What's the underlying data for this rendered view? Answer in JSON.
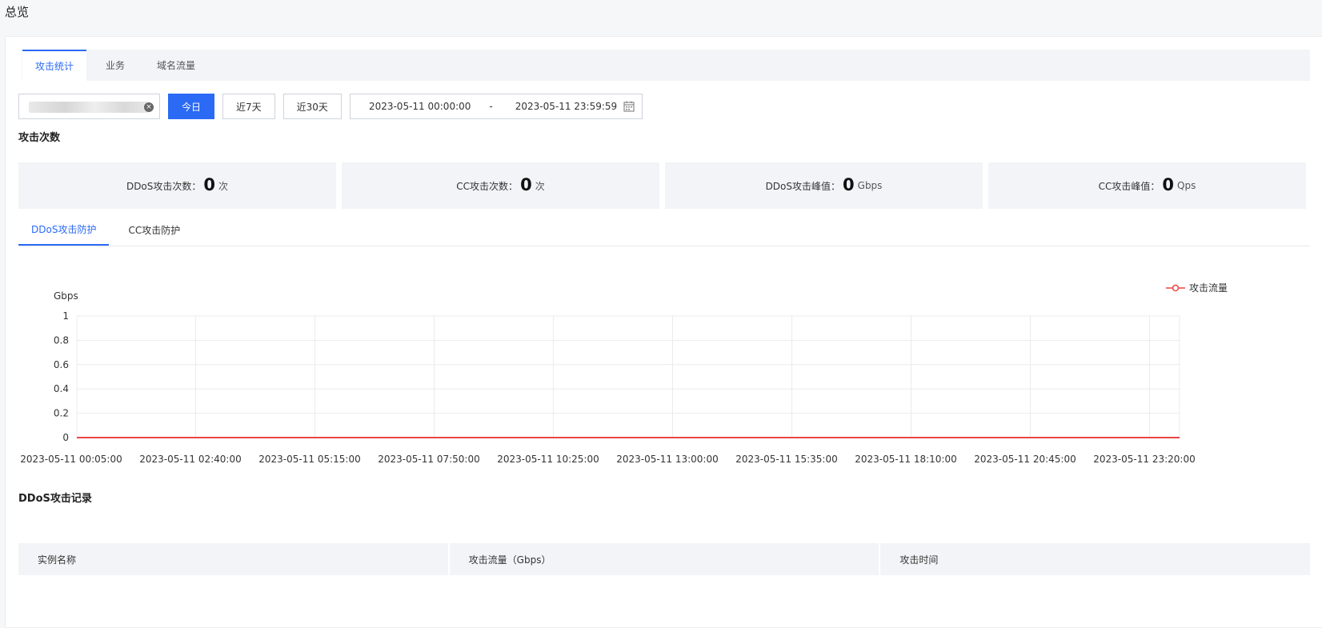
{
  "page": {
    "title": "总览"
  },
  "top_tabs": [
    {
      "label": "攻击统计",
      "active": true
    },
    {
      "label": "业务",
      "active": false
    },
    {
      "label": "域名流量",
      "active": false
    }
  ],
  "filters": {
    "quick_ranges": [
      {
        "label": "今日",
        "active": true
      },
      {
        "label": "近7天",
        "active": false
      },
      {
        "label": "近30天",
        "active": false
      }
    ],
    "date_start": "2023-05-11 00:00:00",
    "date_sep": "-",
    "date_end": "2023-05-11 23:59:59"
  },
  "sections": {
    "attack_count_title": "攻击次数",
    "records_title": "DDoS攻击记录"
  },
  "stats": [
    {
      "label": "DDoS攻击次数：",
      "value": "0",
      "unit": "次"
    },
    {
      "label": "CC攻击次数：",
      "value": "0",
      "unit": "次"
    },
    {
      "label": "DDoS攻击峰值：",
      "value": "0",
      "unit": "Gbps"
    },
    {
      "label": "CC攻击峰值：",
      "value": "0",
      "unit": "Qps"
    }
  ],
  "chart_tabs": [
    {
      "label": "DDoS攻击防护",
      "active": true
    },
    {
      "label": "CC攻击防护",
      "active": false
    }
  ],
  "colors": {
    "accent": "#2b6af5",
    "series_line": "#e84545"
  },
  "chart_data": {
    "type": "line",
    "ylabel": "Gbps",
    "ylim": [
      0,
      1
    ],
    "yticks": [
      "1",
      "0.8",
      "0.6",
      "0.4",
      "0.2",
      "0"
    ],
    "x": [
      "2023-05-11 00:05:00",
      "2023-05-11 02:40:00",
      "2023-05-11 05:15:00",
      "2023-05-11 07:50:00",
      "2023-05-11 10:25:00",
      "2023-05-11 13:00:00",
      "2023-05-11 15:35:00",
      "2023-05-11 18:10:00",
      "2023-05-11 20:45:00",
      "2023-05-11 23:20:00"
    ],
    "series": [
      {
        "name": "攻击流量",
        "values": [
          0,
          0,
          0,
          0,
          0,
          0,
          0,
          0,
          0,
          0
        ]
      }
    ],
    "legend_position": "top-right",
    "grid": true
  },
  "table": {
    "columns": [
      "实例名称",
      "攻击流量（Gbps）",
      "攻击时间"
    ],
    "rows": []
  }
}
